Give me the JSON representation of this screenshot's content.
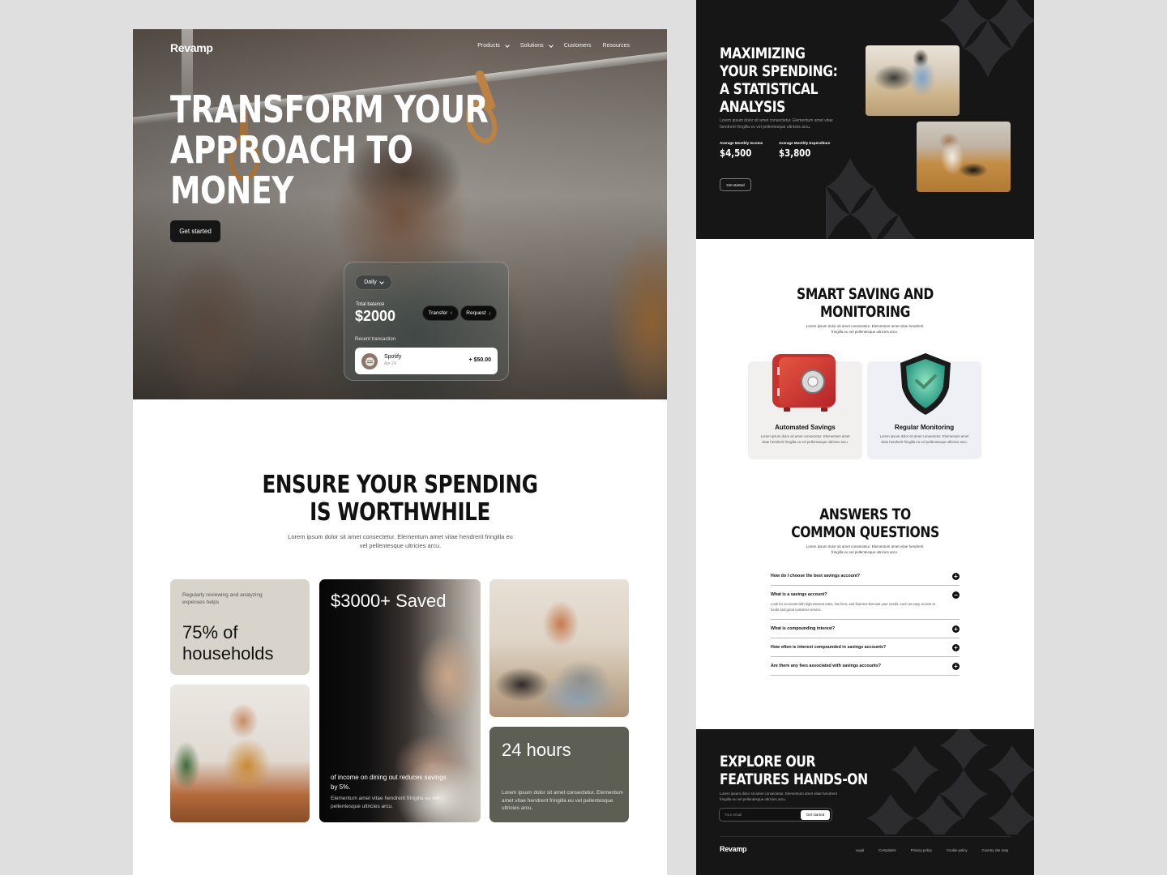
{
  "landing": {
    "brand": "Revamp",
    "nav": [
      {
        "label": "Products",
        "has_dropdown": true
      },
      {
        "label": "Solutions",
        "has_dropdown": true
      },
      {
        "label": "Customers",
        "has_dropdown": false
      },
      {
        "label": "Resources",
        "has_dropdown": false
      }
    ],
    "hero": {
      "title": "Transform your approach to money",
      "cta_label": "Get started"
    },
    "balance_card": {
      "period": "Daily",
      "total_label": "Total balance",
      "total_value": "$2000",
      "transfer_label": "Transfer",
      "request_label": "Request",
      "recent_label": "Recent transaction",
      "transaction": {
        "name": "Spotify",
        "date": "Apr 24",
        "amount": "+ $50.00"
      }
    },
    "ensure": {
      "title_line1": "Ensure your spending",
      "title_line2": "is worthwhile",
      "subtitle": "Lorem ipsum dolor sit amet consectetur. Elementum amet vitae hendrerit fringilla eu vel pellentesque ultricies arcu."
    },
    "cards": {
      "households": {
        "small": "Regularly reviewing and analyzing expenses helps",
        "big": "75% of households"
      },
      "saved": {
        "big": "$3000+ Saved",
        "mid": "of income on dining out reduces savings by 5%.",
        "small": "Elementum amet vitae hendrerit fringilla eu vel pellentesque ultricies arcu."
      },
      "hours": {
        "big": "24 hours",
        "small": "Lorem ipsum dolor sit amet consectetur. Elementum amet vitae hendrerit fringilla eu vel pellentesque ultricies arcu."
      }
    }
  },
  "detail": {
    "stats": {
      "title_line1": "Maximizing",
      "title_line2": "your spending:",
      "title_line3": "a statistical",
      "title_line4": "analysis",
      "subtitle": "Lorem ipsum dolor sit amet consectetur. Elementum amet vitae hendrerit fringilla eu vel pellentesque ultricies arcu.",
      "income_label": "Average Monthly Income",
      "income_value": "$4,500",
      "expenditure_label": "Average Monthly Expenditure",
      "expenditure_value": "$3,800",
      "cta_label": "Get started"
    },
    "smart": {
      "title_line1": "Smart saving and",
      "title_line2": "monitoring",
      "subtitle": "Lorem ipsum dolor sit amet consectetur. Elementum amet vitae hendrerit fringilla eu vel pellentesque ultricies arcu.",
      "features": [
        {
          "title": "Automated Savings",
          "text": "Lorem ipsum dolor sit amet consectetur. Elementum amet vitae hendrerit fringilla eu vel pellentesque ultricies arcu."
        },
        {
          "title": "Regular Monitoring",
          "text": "Lorem ipsum dolor sit amet consectetur. Elementum amet vitae hendrerit fringilla eu vel pellentesque ultricies arcu."
        }
      ]
    },
    "faq": {
      "title_line1": "Answers to",
      "title_line2": "common questions",
      "subtitle": "Lorem ipsum dolor sit amet consectetur. Elementum amet vitae hendrerit fringilla eu vel pellentesque ultricies arcu.",
      "items": [
        {
          "q": "How do I choose the best savings account?",
          "a": "",
          "open": false
        },
        {
          "q": "What is a savings account?",
          "a": "Look for accounts with high-interest rates, low fees, and features that suit your needs, such as easy access to funds and good customer service.",
          "open": true
        },
        {
          "q": "What is compounding interest?",
          "a": "",
          "open": false
        },
        {
          "q": "How often is interest compounded in savings accounts?",
          "a": "",
          "open": false
        },
        {
          "q": "Are there any fees associated with savings accounts?",
          "a": "",
          "open": false
        }
      ]
    },
    "cta": {
      "title_line1": "Explore our",
      "title_line2": "features hands-on",
      "subtitle": "Lorem ipsum dolor sit amet consectetur. Elementum amet vitae hendrerit fringilla eu vel pellentesque ultricies arcu.",
      "email_placeholder": "Your email",
      "submit_label": "Get started"
    },
    "footer": {
      "brand": "Revamp",
      "links": [
        "Legal",
        "Complaints",
        "Privacy policy",
        "Cookie policy",
        "Country site map"
      ]
    }
  }
}
